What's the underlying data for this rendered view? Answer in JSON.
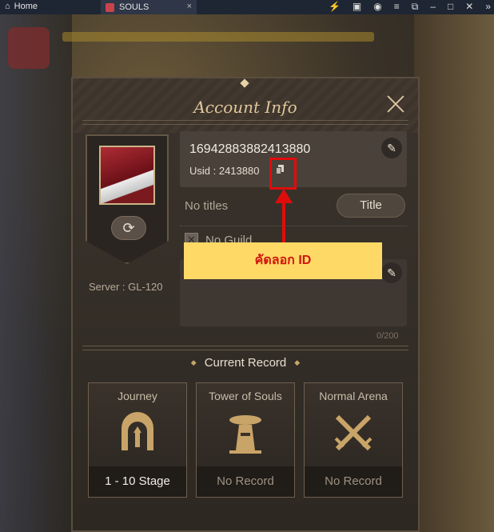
{
  "window": {
    "tabs": [
      {
        "label": "Home",
        "icon": "home-icon"
      },
      {
        "label": "SOULS",
        "icon": "app-icon",
        "active": true
      }
    ],
    "close_tab_symbol": "×",
    "controls": [
      "bolt-icon",
      "gamepad-icon",
      "account-icon",
      "menu-icon",
      "restore-icon",
      "minimize-icon",
      "maximize-icon",
      "close-icon",
      "more-icon"
    ]
  },
  "dialog": {
    "title": "Account Info",
    "user_id": "16942883882413880",
    "usid": "Usid : 2413880",
    "no_titles": "No titles",
    "title_button": "Title",
    "guild": "No Guild",
    "char_count": "0/200",
    "server": "Server : GL-120",
    "current_record_label": "Current Record",
    "records": [
      {
        "title": "Journey",
        "value": "1 - 10 Stage",
        "icon": "gate-icon"
      },
      {
        "title": "Tower of Souls",
        "value": "No Record",
        "icon": "tower-icon"
      },
      {
        "title": "Normal Arena",
        "value": "No Record",
        "icon": "crossed-swords-icon"
      }
    ]
  },
  "annotation": {
    "callout_text": "คัดลอก ID",
    "highlight_color": "#e00c0c",
    "callout_bg": "#ffd966"
  },
  "colors": {
    "title": "#e0c79a",
    "panel": "#3b342d"
  }
}
